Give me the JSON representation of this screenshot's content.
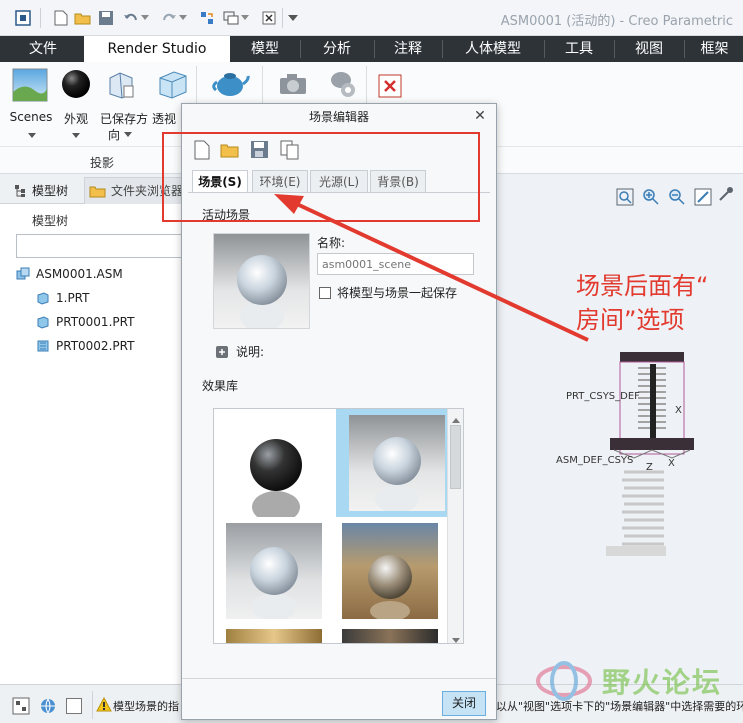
{
  "window": {
    "title": "ASM0001 (活动的) - Creo Parametric"
  },
  "ribbon": {
    "tabs": [
      {
        "label": "文件"
      },
      {
        "label": "Render Studio"
      },
      {
        "label": "模型"
      },
      {
        "label": "分析"
      },
      {
        "label": "注释"
      },
      {
        "label": "人体模型"
      },
      {
        "label": "工具"
      },
      {
        "label": "视图"
      },
      {
        "label": "框架"
      }
    ],
    "buttons": {
      "scenes": "Scenes",
      "appearance": "外观",
      "saved_orient_1": "已保存方",
      "saved_orient_2": "向",
      "perspective": "透视"
    },
    "group_label": "投影"
  },
  "left_panel": {
    "tabs": {
      "model_tree": "模型树",
      "folder_browser": "文件夹浏览器"
    },
    "heading": "模型树",
    "items": [
      "ASM0001.ASM",
      "1.PRT",
      "PRT0001.PRT",
      "PRT0002.PRT"
    ]
  },
  "dialog": {
    "title": "场景编辑器",
    "tabs": [
      "场景(S)",
      "环境(E)",
      "光源(L)",
      "背景(B)"
    ],
    "active_scene_label": "活动场景",
    "name_label": "名称:",
    "name_placeholder": "asm0001_scene",
    "save_with_model": "将模型与场景一起保存",
    "description_label": "说明:",
    "library_label": "效果库",
    "close_button": "关闭"
  },
  "viewport": {
    "csys_label_1": "PRT_CSYS_DEF",
    "csys_label_2": "ASM_DEF_CSYS",
    "axis_x": "X",
    "axis_z": "Z"
  },
  "annotation": {
    "line1": "场景后面有“",
    "line2": "房间”选项"
  },
  "statusbar": {
    "message_left": "模型场景的指",
    "message_right": "以从\"视图\"选项卡下的\"场景编辑器\"中选择需要的环"
  },
  "watermark": "野火论坛",
  "colors": {
    "accent": "#e23a2e",
    "ribbon_dark": "#2e3338"
  }
}
